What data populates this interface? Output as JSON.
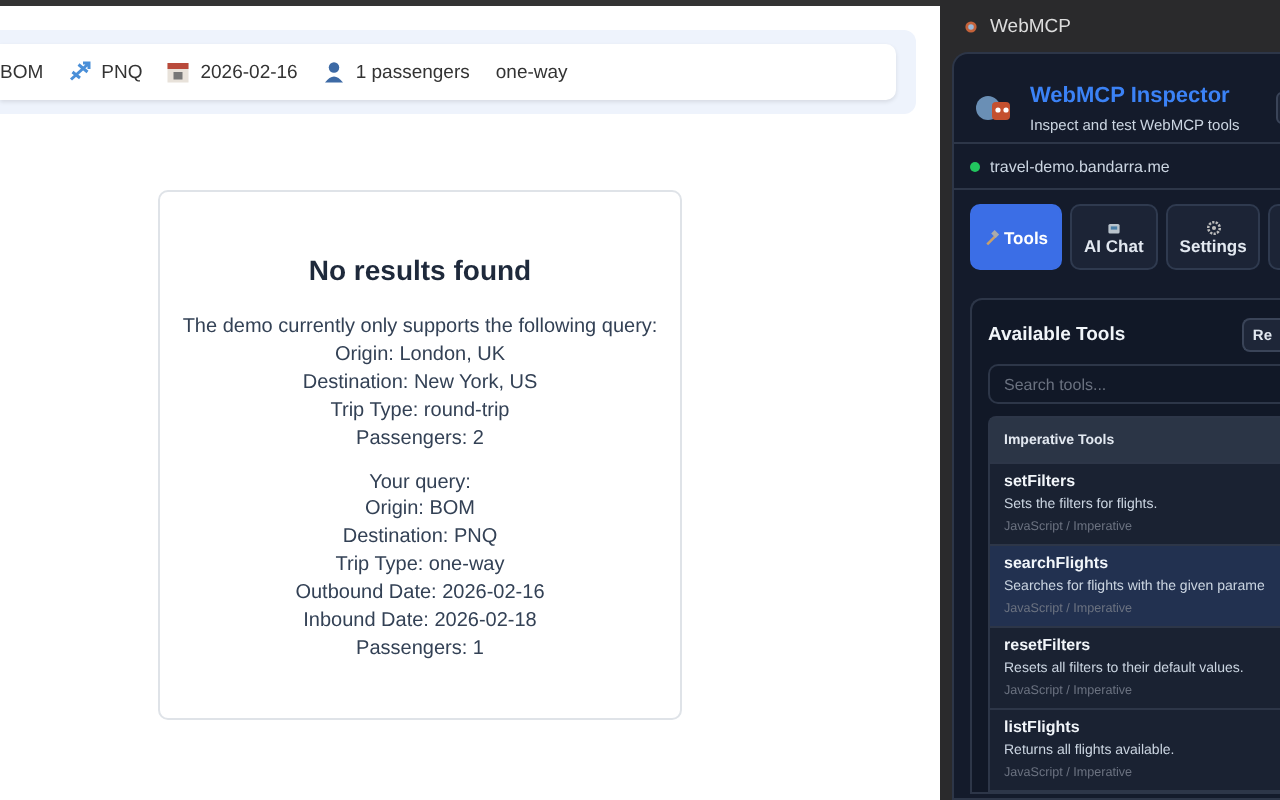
{
  "summary_bar": {
    "origin": "BOM",
    "destination": "PNQ",
    "date": "2026-02-16",
    "passengers": "1 passengers",
    "trip_type": "one-way"
  },
  "result_card": {
    "title": "No results found",
    "supported_intro": "The demo currently only supports the following query:",
    "supported_lines": [
      "Origin: London, UK",
      "Destination: New York, US",
      "Trip Type: round-trip",
      "Passengers: 2"
    ],
    "query_intro": "Your query:",
    "query_lines": [
      "Origin: BOM",
      "Destination: PNQ",
      "Trip Type: one-way",
      "Outbound Date: 2026-02-16",
      "Inbound Date: 2026-02-18",
      "Passengers: 1"
    ]
  },
  "inspector": {
    "window_title": "WebMCP",
    "title": "WebMCP Inspector",
    "subtitle": "Inspect and test WebMCP tools",
    "site": "travel-demo.bandarra.me",
    "tabs": [
      {
        "label": "Tools",
        "selected": true
      },
      {
        "label": "AI Chat",
        "selected": false
      },
      {
        "label": "Settings",
        "selected": false
      }
    ],
    "tools_panel": {
      "title": "Available Tools",
      "refresh_button": "Re",
      "search_placeholder": "Search tools...",
      "group": "Imperative Tools",
      "tools": [
        {
          "name": "setFilters",
          "description": "Sets the filters for flights.",
          "source": "JavaScript / Imperative",
          "selected": false
        },
        {
          "name": "searchFlights",
          "description": "Searches for flights with the given parame",
          "source": "JavaScript / Imperative",
          "selected": true
        },
        {
          "name": "resetFilters",
          "description": "Resets all filters to their default values.",
          "source": "JavaScript / Imperative",
          "selected": false
        },
        {
          "name": "listFlights",
          "description": "Returns all flights available.",
          "source": "JavaScript / Imperative",
          "selected": false
        }
      ]
    }
  }
}
